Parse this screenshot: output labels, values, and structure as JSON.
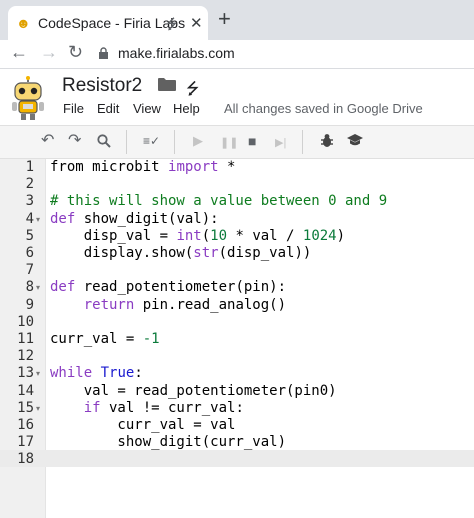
{
  "browser": {
    "tab_title": "CodeSpace - Firia Labs",
    "url": "make.firialabs.com",
    "new_tab_label": "+",
    "close_tab_label": "✕",
    "back_icon": "←",
    "forward_icon": "→",
    "reload_icon": "↻"
  },
  "app": {
    "doc_title": "Resistor2",
    "menu": [
      "File",
      "Edit",
      "View",
      "Help"
    ],
    "save_status": "All changes saved in Google Drive"
  },
  "toolbar": {
    "undo": "↶",
    "redo": "↷",
    "search": "🔍",
    "check": "≡✓",
    "run": "▶",
    "pause": "❚❚",
    "stop": "■",
    "step": "▶|",
    "debug": "🐞",
    "learn": "🎓"
  },
  "editor": {
    "line_numbers": [
      "1",
      "2",
      "3",
      "4",
      "5",
      "6",
      "7",
      "8",
      "9",
      "10",
      "11",
      "12",
      "13",
      "14",
      "15",
      "16",
      "17",
      "18"
    ],
    "lines": [
      [
        {
          "t": "from microbit ",
          "c": ""
        },
        {
          "t": "import",
          "c": "kw"
        },
        {
          "t": " *",
          "c": ""
        }
      ],
      [],
      [
        {
          "t": "# this will show a value between 0 and 9",
          "c": "cm"
        }
      ],
      [
        {
          "t": "def",
          "c": "kw"
        },
        {
          "t": " show_digit(val):",
          "c": ""
        }
      ],
      [
        {
          "t": "    disp_val = ",
          "c": ""
        },
        {
          "t": "int",
          "c": "kw"
        },
        {
          "t": "(",
          "c": ""
        },
        {
          "t": "10",
          "c": "num"
        },
        {
          "t": " * val / ",
          "c": ""
        },
        {
          "t": "1024",
          "c": "num"
        },
        {
          "t": ")",
          "c": ""
        }
      ],
      [
        {
          "t": "    display.show(",
          "c": ""
        },
        {
          "t": "str",
          "c": "kw"
        },
        {
          "t": "(disp_val))",
          "c": ""
        }
      ],
      [],
      [
        {
          "t": "def",
          "c": "kw"
        },
        {
          "t": " read_potentiometer(pin):",
          "c": ""
        }
      ],
      [
        {
          "t": "    ",
          "c": ""
        },
        {
          "t": "return",
          "c": "kw"
        },
        {
          "t": " pin.read_analog()",
          "c": ""
        }
      ],
      [],
      [
        {
          "t": "curr_val = ",
          "c": ""
        },
        {
          "t": "-1",
          "c": "num"
        }
      ],
      [],
      [
        {
          "t": "while",
          "c": "kw"
        },
        {
          "t": " ",
          "c": ""
        },
        {
          "t": "True",
          "c": "kw2"
        },
        {
          "t": ":",
          "c": ""
        }
      ],
      [
        {
          "t": "    val = read_potentiometer(pin0)",
          "c": ""
        }
      ],
      [
        {
          "t": "    ",
          "c": ""
        },
        {
          "t": "if",
          "c": "kw"
        },
        {
          "t": " val != curr_val:",
          "c": ""
        }
      ],
      [
        {
          "t": "        curr_val = val",
          "c": ""
        }
      ],
      [
        {
          "t": "        show_digit(curr_val)",
          "c": ""
        }
      ],
      []
    ],
    "fold_lines": [
      4,
      8,
      13,
      15
    ]
  }
}
